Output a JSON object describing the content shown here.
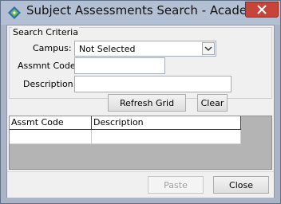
{
  "window": {
    "title": "Subject Assessments Search - Academic"
  },
  "search": {
    "group_title": "Search Criteria",
    "campus_label": "Campus:",
    "campus_value": "Not Selected",
    "assmnt_code_label": "Assmnt Code",
    "assmnt_code_value": "",
    "description_label": "Description:",
    "description_value": "",
    "refresh_label": "Refresh Grid",
    "clear_label": "Clear"
  },
  "grid": {
    "columns": [
      "Assmt Code",
      "Description"
    ],
    "rows": [
      [
        "",
        ""
      ]
    ]
  },
  "footer": {
    "paste_label": "Paste",
    "close_label": "Close"
  },
  "colors": {
    "titlebar": "#b3bfd3",
    "close_button": "#c7443a",
    "client": "#f0f0f0"
  },
  "icons": {
    "app": "diamond-app-icon",
    "close": "close-icon",
    "dropdown": "chevron-down-icon"
  }
}
